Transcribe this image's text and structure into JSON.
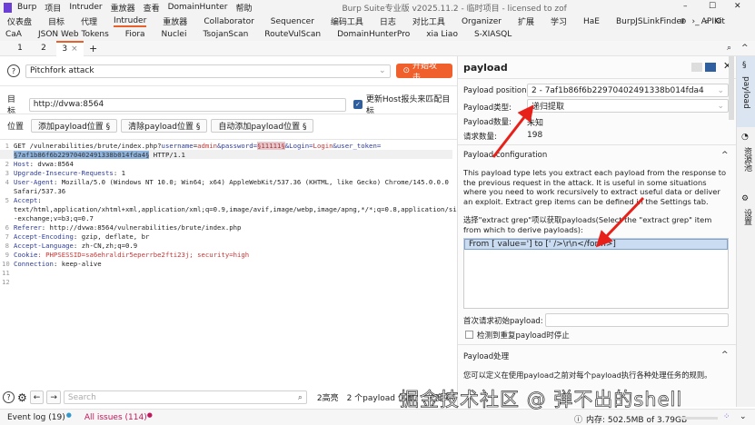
{
  "titlebar": {
    "menus": [
      "Burp",
      "项目",
      "Intruder",
      "重放器",
      "查看",
      "DomainHunter",
      "帮助"
    ],
    "title": "Burp Suite专业版  v2025.11.2 - 临时项目 - licensed to zof"
  },
  "tools_row1": [
    "仪表盘",
    "目标",
    "代理",
    "Intruder",
    "重放器",
    "Collaborator",
    "Sequencer",
    "编码工具",
    "日志",
    "对比工具",
    "Organizer",
    "扩展",
    "学习",
    "HaE",
    "BurpJSLinkFinder",
    "APIKit"
  ],
  "tools_row2": [
    "CaA",
    "JSON Web Tokens",
    "Fiora",
    "Nuclei",
    "TsojanScan",
    "RouteVulScan",
    "DomainHunterPro",
    "xia Liao",
    "S-XIASQL"
  ],
  "subtabs": [
    "1",
    "2",
    "3"
  ],
  "attack": {
    "type": "Pitchfork attack",
    "start_label": "开始攻击"
  },
  "target": {
    "label": "目标",
    "value": "http://dvwa:8564",
    "update_host_label": "更新Host报头来匹配目标",
    "update_host_checked": true
  },
  "positions": {
    "label": "位置",
    "add": "添加payload位置 §",
    "clear": "清除payload位置 §",
    "auto": "自动添加payload位置 §"
  },
  "request": {
    "l1a": "GET /vulnerabilities/brute/index.php?",
    "l1k1": "username",
    "l1v1": "admin",
    "l1k2": "&password=",
    "l1m1": "§11111§",
    "l1k3": "&Login=",
    "l1v3": "Login",
    "l1k4": "&user_token=",
    "l1m2": "§7af1b86f6b22970402491338b014fda4§",
    "l1end": " HTTP/1.1",
    "lines": [
      {
        "n": "2",
        "k": "Host",
        "v": ": dvwa:8564"
      },
      {
        "n": "3",
        "k": "Upgrade-Insecure-Requests",
        "v": ": 1"
      },
      {
        "n": "4",
        "k": "User-Agent",
        "v": ": Mozilla/5.0 (Windows NT 10.0; Win64; x64) AppleWebKit/537.36 (KHTML, like Gecko) Chrome/145.0.0.0"
      },
      {
        "n": "",
        "k": "",
        "v": "Safari/537.36"
      },
      {
        "n": "5",
        "k": "Accept",
        "v": ":"
      },
      {
        "n": "",
        "k": "",
        "v": "text/html,application/xhtml+xml,application/xml;q=0.9,image/avif,image/webp,image/apng,*/*;q=0.8,application/signed"
      },
      {
        "n": "",
        "k": "",
        "v": "-exchange;v=b3;q=0.7"
      },
      {
        "n": "6",
        "k": "Referer",
        "v": ": http://dvwa:8564/vulnerabilities/brute/index.php"
      },
      {
        "n": "7",
        "k": "Accept-Encoding",
        "v": ": gzip, deflate, br"
      },
      {
        "n": "8",
        "k": "Accept-Language",
        "v": ": zh-CN,zh;q=0.9"
      },
      {
        "n": "9",
        "k": "Cookie",
        "v": ": PHPSESSID=sa6ehraldir5eperrbe2fti23j; security=high"
      },
      {
        "n": "10",
        "k": "Connection",
        "v": ": keep-alive"
      },
      {
        "n": "11",
        "k": "",
        "v": ""
      },
      {
        "n": "12",
        "k": "",
        "v": ""
      }
    ]
  },
  "bottombar": {
    "search_placeholder": "Search",
    "highlights": "2高亮",
    "payload_positions": "2 个payload 位置?",
    "length": "长度:66"
  },
  "status": {
    "event_log": "Event log (19)",
    "all_issues": "All issues (114)",
    "memory": "内存: 502.5MB of 3.79GB"
  },
  "panel": {
    "title": "payload",
    "position_label": "Payload position:",
    "position_value": "2 - 7af1b86f6b22970402491338b014fda4",
    "type_label": "Payload类型:",
    "type_value": "递归提取",
    "count_label": "Payload数量:",
    "count_value": "未知",
    "requests_label": "请求数量:",
    "requests_value": "198",
    "config_title": "Payload configuration",
    "config_desc": "This payload type lets you extract each payload from the response to the previous request in the attack. It is useful in some situations where you need to work recursively to extract useful data or deliver an exploit. Extract grep items can be defined in the Settings tab.",
    "select_label": "选择\"extract grep\"项以获取payloads(Select the \"extract grep\" item from which to derive payloads):",
    "grep_items": [
      "From [ value='] to [' />\\r\\n</form>]"
    ],
    "initial_label": "首次请求初始payload:",
    "initial_value": "",
    "stop_label": "检测到重复payload时停止",
    "processing_title": "Payload处理",
    "processing_desc": "您可以定义在使用payload之前对每个payload执行各种处理任务的规则。"
  },
  "sidebar": {
    "items": [
      "payload",
      "资源池",
      "设置"
    ]
  },
  "watermark": "掘金技术社区 @ 弹不出的shell",
  "colors": {
    "accent": "#f0602c",
    "selection": "#8fb4dd",
    "arrow": "#e8201a"
  }
}
